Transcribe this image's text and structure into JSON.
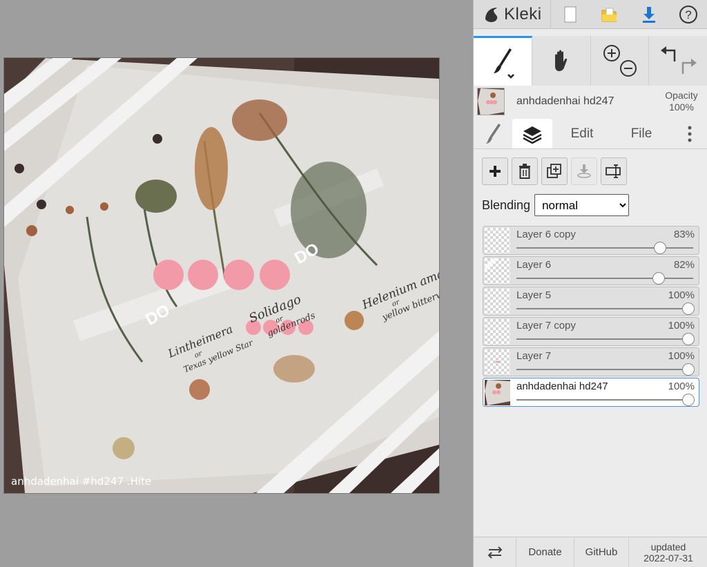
{
  "app": {
    "name": "Kleki"
  },
  "topbar": {
    "new_icon": "new-file-icon",
    "open_icon": "open-folder-icon",
    "save_icon": "download-icon",
    "help_icon": "help-icon"
  },
  "canvas": {
    "watermark": "anhdadenhai #hd247 .Hite",
    "handwriting": [
      "Lintheimera",
      "or",
      "Texas yellow Star",
      "Solidago",
      "or",
      "goldenrods",
      "Helenium amarum",
      "or",
      "yellow bitterweed"
    ]
  },
  "current_layer": {
    "name": "anhdadenhai hd247",
    "opacity_label": "Opacity",
    "opacity_value": "100%"
  },
  "tabs": {
    "edit": "Edit",
    "file": "File"
  },
  "blending": {
    "label": "Blending",
    "value": "normal",
    "options": [
      "normal"
    ]
  },
  "layers": [
    {
      "name": "Layer 6 copy",
      "opacity": "83%",
      "level": 0.83
    },
    {
      "name": "Layer 6",
      "opacity": "82%",
      "level": 0.82
    },
    {
      "name": "Layer 5",
      "opacity": "100%",
      "level": 1.0
    },
    {
      "name": "Layer 7 copy",
      "opacity": "100%",
      "level": 1.0
    },
    {
      "name": "Layer 7",
      "opacity": "100%",
      "level": 1.0
    },
    {
      "name": "anhdadenhai hd247",
      "opacity": "100%",
      "level": 1.0,
      "selected": true
    }
  ],
  "bottombar": {
    "donate": "Donate",
    "github": "GitHub",
    "updated_label": "updated",
    "updated_date": "2022-07-31"
  },
  "colors": {
    "accent": "#2196f3",
    "pink_dots": "#f29aa8"
  }
}
